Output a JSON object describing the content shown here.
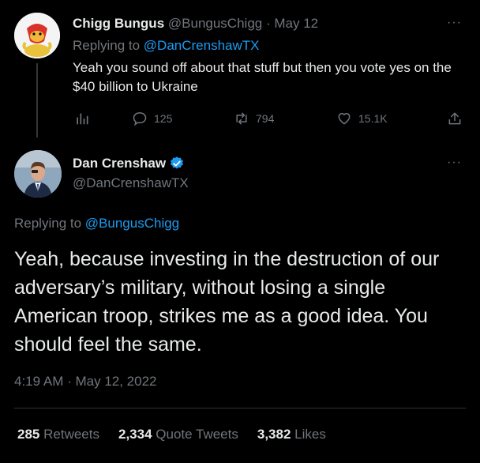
{
  "reply_tweet": {
    "display_name": "Chigg Bungus",
    "handle": "@BungusChigg",
    "date": "· May 12",
    "replying_prefix": "Replying to",
    "replying_to": "@DanCrenshawTX",
    "text": "Yeah you sound off about that stuff but then you vote yes on the $40 billion to Ukraine",
    "more": "···",
    "actions": {
      "analytics_icon": "analytics-icon",
      "reply_count": "125",
      "retweet_count": "794",
      "like_count": "15.1K",
      "share_icon": "share-icon"
    }
  },
  "main_tweet": {
    "display_name": "Dan Crenshaw",
    "verified_icon": "verified-badge-icon",
    "handle": "@DanCrenshawTX",
    "more": "···",
    "replying_prefix": "Replying to",
    "replying_to": "@BungusChigg",
    "text": "Yeah, because investing in the destruction of our adversary’s military, without losing a single American troop, strikes me as a good idea. You should feel the same.",
    "timestamp": "4:19 AM · May 12, 2022",
    "stats": {
      "retweets_count": "285",
      "retweets_label": "Retweets",
      "quotes_count": "2,334",
      "quotes_label": "Quote Tweets",
      "likes_count": "3,382",
      "likes_label": "Likes"
    }
  },
  "colors": {
    "background": "#000000",
    "text": "#e7e9ea",
    "muted": "#71767b",
    "link": "#1d9bf0"
  }
}
